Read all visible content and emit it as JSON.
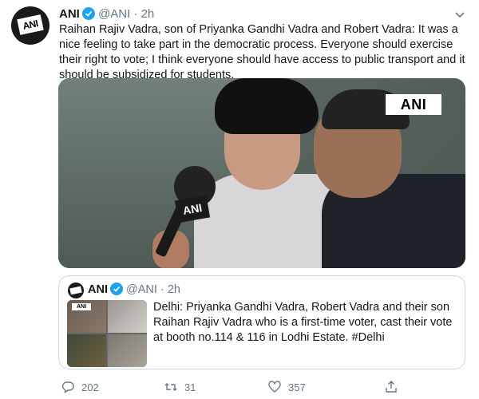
{
  "tweet": {
    "author_name": "ANI",
    "author_handle": "@ANI",
    "separator": "·",
    "time": "2h",
    "text": "Raihan Rajiv Vadra, son of Priyanka Gandhi Vadra and Robert Vadra: It was a nice feeling to take part in the democratic process. Everyone should exercise their right to vote; I think everyone should have access to public transport and it should be subsidized for students.",
    "avatar_logo": "ANI",
    "media_watermark": "ANI",
    "mic_label": "ANI"
  },
  "quoted": {
    "author_name": "ANI",
    "author_handle": "@ANI",
    "separator": "·",
    "time": "2h",
    "text": "Delhi: Priyanka Gandhi Vadra, Robert Vadra and their son Raihan Rajiv Vadra who is a first-time voter, cast their vote at booth no.114 & 116 in Lodhi Estate. #Delhi",
    "thumb_watermark": "ANI"
  },
  "actions": {
    "reply_count": "202",
    "retweet_count": "31",
    "like_count": "357"
  },
  "icons": {
    "verified": "verified-badge-icon",
    "caret": "chevron-down-icon",
    "reply": "reply-icon",
    "retweet": "retweet-icon",
    "like": "heart-icon",
    "share": "share-icon"
  },
  "colors": {
    "accent": "#1da1f2",
    "text": "#14171a",
    "muted": "#657786",
    "border": "#ccd6dd"
  }
}
